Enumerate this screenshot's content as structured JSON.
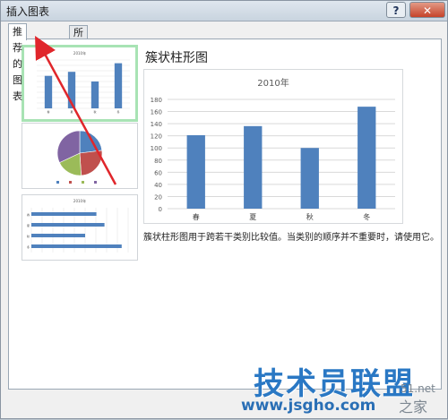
{
  "window": {
    "title": "插入图表",
    "help_label": "?",
    "close_label": "✕"
  },
  "tabs": [
    {
      "label": "推荐的图表"
    },
    {
      "label": "所有图表"
    }
  ],
  "preview": {
    "heading": "簇状柱形图",
    "description": "簇状柱形图用于跨若干类别比较值。当类别的顺序并不重要时，请使用它。"
  },
  "chart_data": [
    {
      "type": "bar",
      "title": "2010年",
      "categories": [
        "春",
        "夏",
        "秋",
        "冬"
      ],
      "values": [
        121,
        136,
        100,
        168
      ],
      "ylim": [
        0,
        180
      ],
      "yticks": [
        0,
        20,
        40,
        60,
        80,
        100,
        120,
        140,
        160,
        180
      ],
      "grid": true,
      "color": "#4f81bd"
    },
    {
      "type": "pie",
      "title": "",
      "values": [
        121,
        136,
        100,
        168
      ],
      "colors": [
        "#4f81bd",
        "#c0504d",
        "#9bbb59",
        "#8064a2"
      ]
    },
    {
      "type": "bar",
      "orientation": "horizontal",
      "title": "2010年",
      "categories": [
        "春",
        "夏",
        "秋",
        "冬"
      ],
      "values": [
        121,
        136,
        100,
        168
      ],
      "color": "#4f81bd"
    }
  ],
  "watermark": {
    "text": "技术员联盟",
    "url": "www.jsgho.com",
    "side1": "51.net",
    "side2": "之家"
  },
  "colors": {
    "accent": "#4f81bd",
    "arrow": "#e0262b",
    "selected_border": "#a8e3b4"
  }
}
